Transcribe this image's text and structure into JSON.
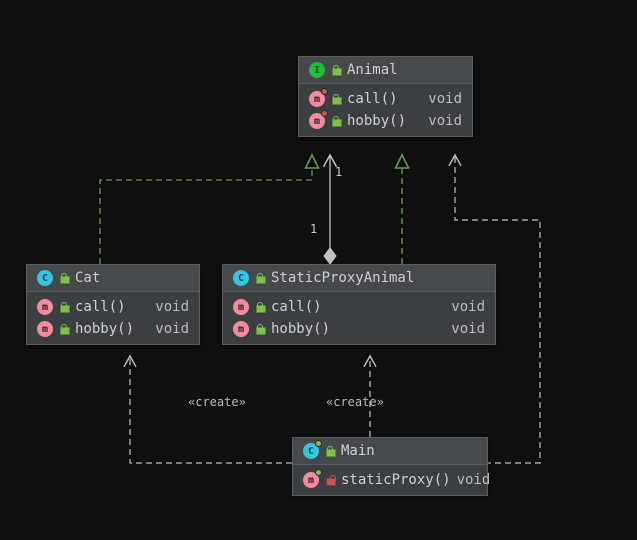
{
  "icons": {
    "interface": "I",
    "class": "C",
    "method": "m"
  },
  "classes": {
    "animal": {
      "name": "Animal",
      "kind": "interface",
      "methods": [
        {
          "name": "call()",
          "ret": "void"
        },
        {
          "name": "hobby()",
          "ret": "void"
        }
      ]
    },
    "cat": {
      "name": "Cat",
      "kind": "class",
      "methods": [
        {
          "name": "call()",
          "ret": "void"
        },
        {
          "name": "hobby()",
          "ret": "void"
        }
      ]
    },
    "staticProxy": {
      "name": "StaticProxyAnimal",
      "kind": "class",
      "methods": [
        {
          "name": "call()",
          "ret": "void"
        },
        {
          "name": "hobby()",
          "ret": "void"
        }
      ]
    },
    "main": {
      "name": "Main",
      "kind": "class",
      "methods": [
        {
          "name": "staticProxy()",
          "ret": "void"
        }
      ]
    }
  },
  "relations": {
    "realize1": {
      "from": "Cat",
      "to": "Animal",
      "type": "realization"
    },
    "realize2": {
      "from": "StaticProxyAnimal",
      "to": "Animal",
      "type": "realization"
    },
    "aggregation": {
      "from": "StaticProxyAnimal",
      "to": "Animal",
      "type": "composition",
      "multA": "1",
      "multB": "1"
    },
    "create1": {
      "from": "Main",
      "to": "Cat",
      "type": "dependency",
      "stereotype": "«create»"
    },
    "create2": {
      "from": "Main",
      "to": "StaticProxyAnimal",
      "type": "dependency",
      "stereotype": "«create»"
    },
    "dep1": {
      "from": "Main",
      "to": "Animal",
      "type": "dependency"
    }
  },
  "colors": {
    "background": "#0f0f0f",
    "box": "#3c3f41",
    "header": "#46494b",
    "border": "#5a5d5f",
    "realization": "#6a9955",
    "dependency": "#c0c0c0",
    "interfaceBadge": "#1fbe3c",
    "classBadge": "#35c5e0",
    "methodBadge": "#f08ba0",
    "lockOpen": "#7fbf4d",
    "lockPrivate": "#c75450"
  }
}
